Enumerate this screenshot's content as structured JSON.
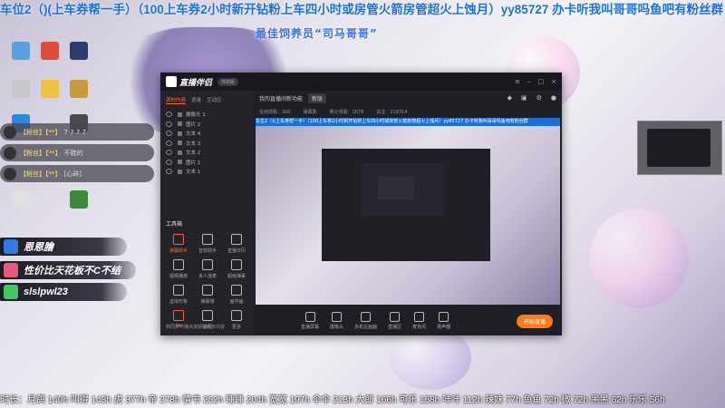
{
  "top_banner": "车位2（)(上车券帮一手）（100上车券2小时新开钻粉上车四小时或房管火箭房管超火上蚀月）yy85727 办卡听我叫哥哥吗鱼吧有粉丝群",
  "sub_banner": "最佳饲养员“司马哥哥”",
  "chat": {
    "rows": [
      {
        "user": "【粉丝】【**】",
        "msg": "7 7 7 7"
      },
      {
        "user": "【粉丝】【**】",
        "msg": "不鞋的"
      },
      {
        "user": "【粉丝】【**】",
        "msg": "[心碎]"
      }
    ]
  },
  "gifts": [
    {
      "name": "恩恩膾",
      "color": "#2f7ae5"
    },
    {
      "name": "性价比天花板不C不结",
      "color": "#e25c7a"
    },
    {
      "name": "slslpwl23",
      "color": "#46c46a"
    }
  ],
  "app": {
    "title": "直播伴侣",
    "version": "体验版",
    "left_tabs": [
      "源材内容",
      "语录",
      "互动区"
    ],
    "sources": [
      "摄像头 1",
      "图片 2",
      "文本 4",
      "文本 3",
      "文本 2",
      "图片 1",
      "文本 1"
    ],
    "tools_title": "工具箱",
    "tools": [
      "弹幕助手",
      "音效助手",
      "直播日历",
      "视频播放",
      "多人连麦",
      "超级弹幕",
      "虚拟形象",
      "弹幕墙",
      "画中画",
      "PK",
      "连线",
      "更多"
    ],
    "footer": "到同步开播点将获取更多内容",
    "right_title": "我的直播间新功能",
    "right_btn": "新版",
    "stats": [
      "在线观看：300",
      "弹幕数",
      "累计观看：1678",
      "关注：219314"
    ],
    "bottom_tools": [
      "直播屏幕",
      "摄像头",
      "多机位画面",
      "直播区",
      "麦克风",
      "扬声器"
    ],
    "live_btn": "开始直播"
  },
  "ticker": "时长：月鸽 140h 叫得 143h 虎 377h 帝 278h 情书 252h 睡睡 204h 宽宽 197h 伞伞 213h 大郎 166h 可乐 158h 咔咔 112h 辣妹 77h 鱼鱼 72h 微 72h 黑黑 62h 乐乐 56h"
}
